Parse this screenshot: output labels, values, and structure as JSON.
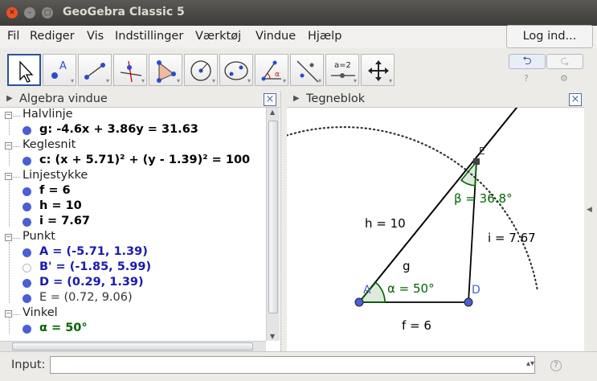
{
  "window": {
    "title": "GeoGebra Classic 5"
  },
  "menu": [
    "Fil",
    "Rediger",
    "Vis",
    "Indstillinger",
    "Værktøj",
    "Vindue",
    "Hjælp"
  ],
  "login_label": "Log ind...",
  "toolbar": {
    "tools": [
      "move-tool",
      "point-tool",
      "segment-tool",
      "perpendicular-line-tool",
      "polygon-tool",
      "circle-center-point-tool",
      "ellipse-tool",
      "angle-tool",
      "reflect-tool",
      "slider-tool",
      "move-graphics-view-tool"
    ],
    "slider_label": "a=2",
    "point_label": "A",
    "angle_symbol": "α",
    "undo_icon": "⮌",
    "redo_icon": "⮎",
    "help_icon": "?",
    "settings_icon": "⚙"
  },
  "algebra": {
    "title": "Algebra vindue",
    "rows": [
      {
        "kind": "category",
        "text": "Halvlinje"
      },
      {
        "kind": "item",
        "text": "g: -4.6x + 3.86y = 31.63",
        "color": "#000000",
        "dot": "#4a5fd6"
      },
      {
        "kind": "category",
        "text": "Keglesnit"
      },
      {
        "kind": "item",
        "text": "c: (x + 5.71)² + (y - 1.39)² = 100",
        "color": "#000000",
        "dot": "#4a5fd6"
      },
      {
        "kind": "category",
        "text": "Linjestykke"
      },
      {
        "kind": "item",
        "text": "f = 6",
        "color": "#000000",
        "dot": "#4a5fd6"
      },
      {
        "kind": "item",
        "text": "h = 10",
        "color": "#000000",
        "dot": "#4a5fd6"
      },
      {
        "kind": "item",
        "text": "i = 7.67",
        "color": "#000000",
        "dot": "#4a5fd6"
      },
      {
        "kind": "category",
        "text": "Punkt"
      },
      {
        "kind": "item",
        "text": "A = (-5.71, 1.39)",
        "color": "#1a1ab0",
        "dot": "#4a5fd6"
      },
      {
        "kind": "item",
        "text": "B' = (-1.85, 5.99)",
        "color": "#1a1ab0",
        "dot": "hollow"
      },
      {
        "kind": "item",
        "text": "D = (0.29, 1.39)",
        "color": "#1a1ab0",
        "dot": "#4a5fd6"
      },
      {
        "kind": "item",
        "text": "E = (0.72, 9.06)",
        "color": "#333333",
        "dot": "#4a5fd6",
        "light": true
      },
      {
        "kind": "category",
        "text": "Vinkel"
      },
      {
        "kind": "item",
        "text": "α = 50°",
        "color": "#006400",
        "dot": "#4a5fd6"
      }
    ]
  },
  "graphics": {
    "title": "Tegneblok",
    "label_h": "h = 10",
    "label_i": "i = 7.67",
    "label_f": "f = 6",
    "label_g": "g",
    "label_A": "A",
    "label_D": "D",
    "label_E": "E",
    "label_alpha": "α = 50°",
    "label_beta": "β = 36.8°",
    "colors": {
      "point": "#4a5fd6",
      "angle": "#006400",
      "dark_point": "#333333"
    }
  },
  "input": {
    "label": "Input:",
    "value": "",
    "help_icon": "?"
  }
}
